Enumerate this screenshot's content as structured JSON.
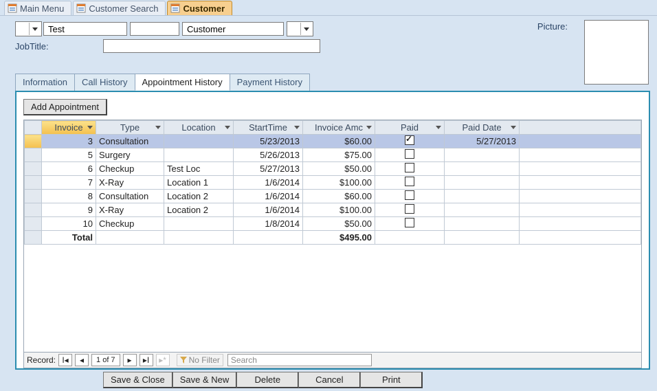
{
  "doctabs": [
    {
      "label": "Main Menu",
      "active": false
    },
    {
      "label": "Customer Search",
      "active": false
    },
    {
      "label": "Customer",
      "active": true
    }
  ],
  "form": {
    "title_prefix_value": "",
    "first_name": "Test",
    "middle_name": "",
    "last_name": "Customer",
    "suffix_value": "",
    "jobtitle_label": "JobTitle:",
    "jobtitle_value": "",
    "picture_label": "Picture:"
  },
  "inner_tabs": {
    "items": [
      "Information",
      "Call History",
      "Appointment History",
      "Payment History"
    ],
    "active_index": 2
  },
  "appt": {
    "add_button": "Add Appointment",
    "columns": [
      "Invoice",
      "Type",
      "Location",
      "StartTime",
      "Invoice Amc",
      "Paid",
      "Paid Date"
    ],
    "sorted_column_index": 0,
    "rows": [
      {
        "invoice": "3",
        "type": "Consultation",
        "location": "",
        "start": "5/23/2013",
        "amount": "$60.00",
        "paid": true,
        "paid_date": "5/27/2013",
        "selected": true
      },
      {
        "invoice": "5",
        "type": "Surgery",
        "location": "",
        "start": "5/26/2013",
        "amount": "$75.00",
        "paid": false,
        "paid_date": ""
      },
      {
        "invoice": "6",
        "type": "Checkup",
        "location": "Test Loc",
        "start": "5/27/2013",
        "amount": "$50.00",
        "paid": false,
        "paid_date": ""
      },
      {
        "invoice": "7",
        "type": "X-Ray",
        "location": "Location 1",
        "start": "1/6/2014",
        "amount": "$100.00",
        "paid": false,
        "paid_date": ""
      },
      {
        "invoice": "8",
        "type": "Consultation",
        "location": "Location 2",
        "start": "1/6/2014",
        "amount": "$60.00",
        "paid": false,
        "paid_date": ""
      },
      {
        "invoice": "9",
        "type": "X-Ray",
        "location": "Location 2",
        "start": "1/6/2014",
        "amount": "$100.00",
        "paid": false,
        "paid_date": ""
      },
      {
        "invoice": "10",
        "type": "Checkup",
        "location": "",
        "start": "1/8/2014",
        "amount": "$50.00",
        "paid": false,
        "paid_date": ""
      }
    ],
    "total_label": "Total",
    "total_amount": "$495.00"
  },
  "recnav": {
    "label": "Record:",
    "counter": "1 of 7",
    "filter_label": "No Filter",
    "search_placeholder": "Search"
  },
  "actions": {
    "save_close": "Save & Close",
    "save_new": "Save & New",
    "delete": "Delete",
    "cancel": "Cancel",
    "print": "Print"
  }
}
